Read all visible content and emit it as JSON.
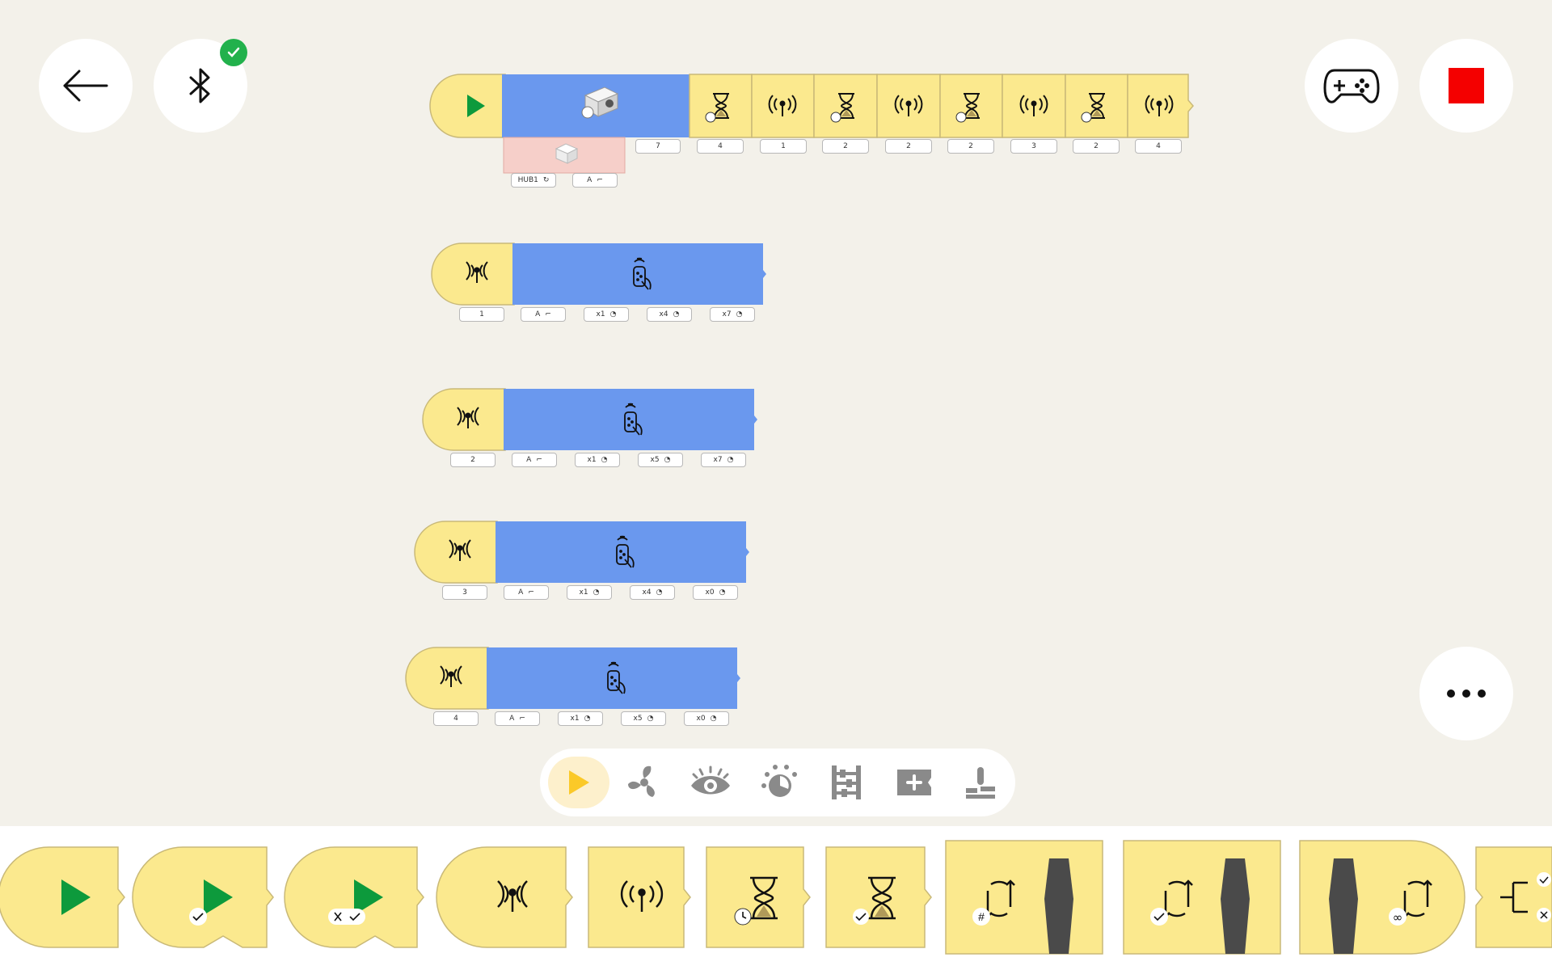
{
  "header": {
    "back_icon": "arrow-left-icon",
    "bluetooth_icon": "bluetooth-icon",
    "bluetooth_status": "connected",
    "controller_icon": "gamepad-icon",
    "stop_icon": "stop-square-icon",
    "more_icon": "ellipsis-icon"
  },
  "colors": {
    "background": "#f3f1ea",
    "block_yellow": "#fbe98e",
    "block_blue": "#6a98ee",
    "block_pink": "#f6cfc9",
    "accent_green": "#0d9a3c",
    "status_green": "#22b14c",
    "stop_red": "#f40000"
  },
  "program": {
    "main_row": {
      "start_icon": "play-icon",
      "motor_value": "7",
      "hub_label": "HUB1",
      "port_label": "A",
      "steps": [
        {
          "icon": "hourglass-icon",
          "value": "4"
        },
        {
          "icon": "broadcast-icon",
          "value": "1"
        },
        {
          "icon": "hourglass-icon",
          "value": "2"
        },
        {
          "icon": "broadcast-icon",
          "value": "2"
        },
        {
          "icon": "hourglass-icon",
          "value": "2"
        },
        {
          "icon": "broadcast-icon",
          "value": "3"
        },
        {
          "icon": "hourglass-icon",
          "value": "2"
        },
        {
          "icon": "broadcast-icon",
          "value": "4"
        }
      ]
    },
    "remote_rows": [
      {
        "trigger": "1",
        "port": "A",
        "params": [
          "x1",
          "x4",
          "x7"
        ]
      },
      {
        "trigger": "2",
        "port": "A",
        "params": [
          "x1",
          "x5",
          "x7"
        ]
      },
      {
        "trigger": "3",
        "port": "A",
        "params": [
          "x1",
          "x4",
          "x0"
        ]
      },
      {
        "trigger": "4",
        "port": "A",
        "params": [
          "x1",
          "x5",
          "x0"
        ]
      }
    ]
  },
  "palette": {
    "categories": [
      {
        "name": "events",
        "icon": "play-icon",
        "active": true
      },
      {
        "name": "motors",
        "icon": "fan-icon",
        "active": false
      },
      {
        "name": "sensors",
        "icon": "eye-icon",
        "active": false
      },
      {
        "name": "lights",
        "icon": "light-icon",
        "active": false
      },
      {
        "name": "control",
        "icon": "abacus-icon",
        "active": false
      },
      {
        "name": "more",
        "icon": "add-block-icon",
        "active": false
      },
      {
        "name": "tools",
        "icon": "joystick-icon",
        "active": false
      }
    ]
  },
  "tray": {
    "blocks": [
      {
        "name": "start-on-play",
        "icon": "play-icon",
        "badge": ""
      },
      {
        "name": "start-on-condition",
        "icon": "play-icon",
        "badge": "✓"
      },
      {
        "name": "start-on-change",
        "icon": "play-icon",
        "badge": "×✓"
      },
      {
        "name": "on-message",
        "icon": "receive-icon",
        "badge": ""
      },
      {
        "name": "send-message",
        "icon": "broadcast-icon",
        "badge": ""
      },
      {
        "name": "wait-time",
        "icon": "hourglass-icon",
        "badge": "◷"
      },
      {
        "name": "wait-until",
        "icon": "hourglass-icon",
        "badge": "✓"
      },
      {
        "name": "repeat-count",
        "icon": "loop-icon",
        "badge": "#"
      },
      {
        "name": "repeat-until",
        "icon": "loop-icon",
        "badge": "✓"
      },
      {
        "name": "repeat-forever",
        "icon": "loop-icon",
        "badge": "∞"
      },
      {
        "name": "if-else",
        "icon": "branch-icon",
        "badge": ""
      }
    ]
  }
}
